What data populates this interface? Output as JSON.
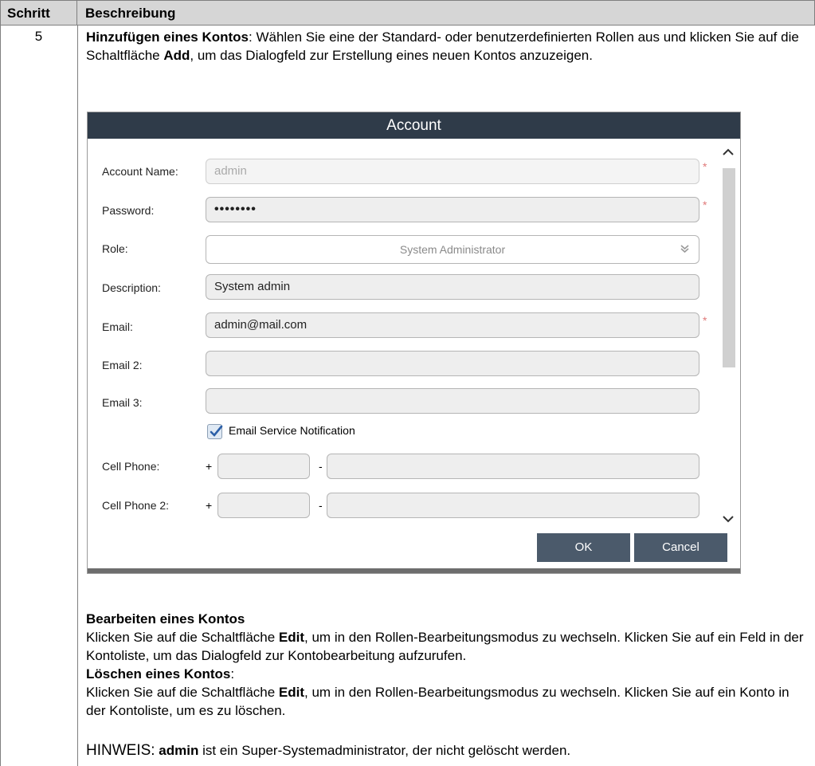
{
  "table": {
    "header_step": "Schritt",
    "header_desc": "Beschreibung",
    "step_number": "5"
  },
  "text": {
    "add_heading": "Hinzufügen eines Kontos",
    "add_body_1": ": Wählen Sie eine der Standard- oder benutzerdefinierten Rollen aus und klicken Sie auf die Schaltfläche ",
    "add_button": "Add",
    "add_body_2": ", um das Dialogfeld zur Erstellung eines neuen Kontos anzuzeigen.",
    "edit_heading": "Bearbeiten eines Kontos",
    "edit_body_1": "Klicken Sie auf die Schaltfläche ",
    "edit_button": "Edit",
    "edit_body_2": ", um in den Rollen-Bearbeitungsmodus zu wechseln. Klicken Sie auf ein Feld in der Kontoliste, um das Dialogfeld zur Kontobearbeitung aufzurufen.",
    "delete_heading": "Löschen eines Kontos",
    "delete_colon": ":",
    "delete_body_1": "Klicken Sie auf die Schaltfläche ",
    "delete_button": "Edit",
    "delete_body_2": ", um in den Rollen-Bearbeitungsmodus zu wechseln. Klicken Sie auf ein Konto in der Kontoliste, um es zu löschen.",
    "note_label": "HINWEIS:",
    "note_user": "admin",
    "note_body": " ist ein Super-Systemadministrator, der nicht gelöscht werden."
  },
  "dialog": {
    "title": "Account",
    "labels": {
      "account_name": "Account Name:",
      "password": "Password:",
      "role": "Role:",
      "description": "Description:",
      "email": "Email:",
      "email2": "Email 2:",
      "email3": "Email 3:",
      "cell_phone": "Cell Phone:",
      "cell_phone2": "Cell Phone 2:"
    },
    "values": {
      "account_name": "admin",
      "password": "••••••••",
      "role": "System Administrator",
      "description": "System admin",
      "email": "admin@mail.com",
      "email2": "",
      "email3": ""
    },
    "required_marker": "*",
    "checkbox_label": "Email Service Notification",
    "checkbox_checked": true,
    "phone_plus": "+",
    "phone_dash": "-",
    "ok_label": "OK",
    "cancel_label": "Cancel"
  }
}
